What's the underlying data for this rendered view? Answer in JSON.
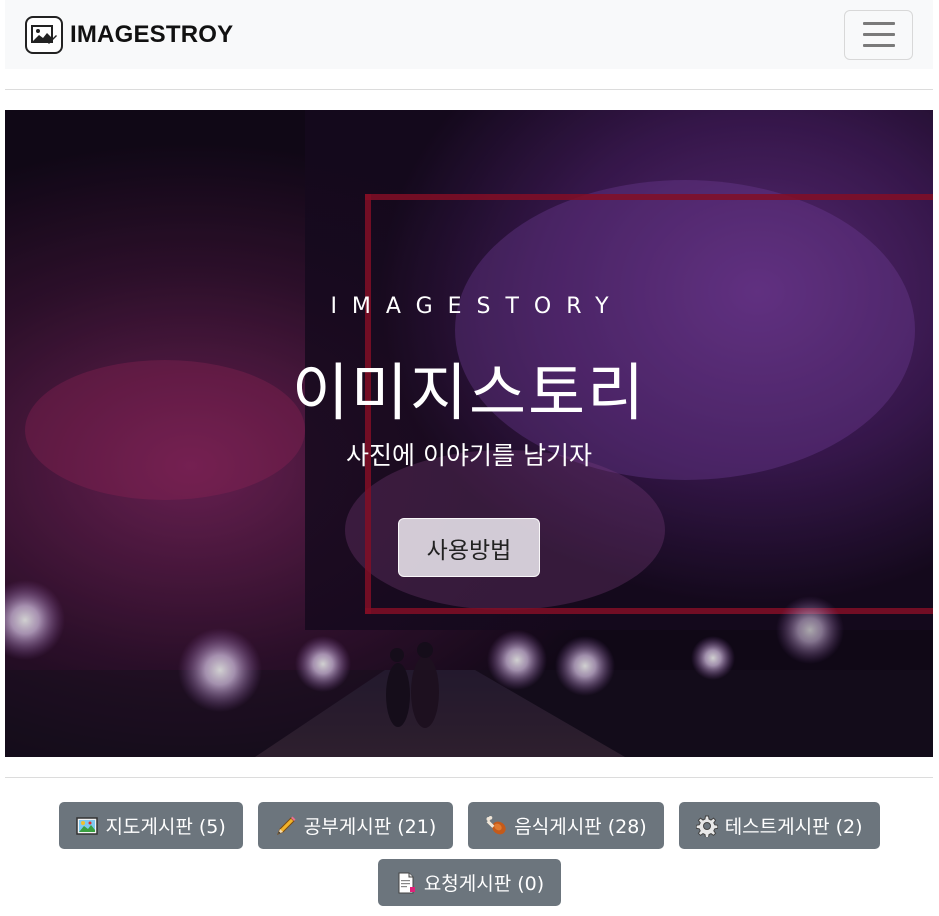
{
  "navbar": {
    "brand": "IMAGESTROY",
    "logo_icon": "image-edit-icon",
    "menu_icon": "hamburger-icon"
  },
  "hero": {
    "eyebrow": "IMAGESTORY",
    "title": "이미지스토리",
    "subtitle": "사진에 이야기를 남기자",
    "button_label": "사용방법"
  },
  "boards": [
    {
      "icon": "map-picture-icon",
      "label": "지도게시판 (5)"
    },
    {
      "icon": "pencil-icon",
      "label": "공부게시판 (21)"
    },
    {
      "icon": "drumstick-icon",
      "label": "음식게시판 (28)"
    },
    {
      "icon": "gear-icon",
      "label": "테스트게시판 (2)"
    },
    {
      "icon": "document-icon",
      "label": "요청게시판 (0)"
    }
  ],
  "colors": {
    "navbar_bg": "#f8f9fa",
    "board_button_bg": "#6c757d",
    "hero_accent_frame": "#a0122e"
  }
}
